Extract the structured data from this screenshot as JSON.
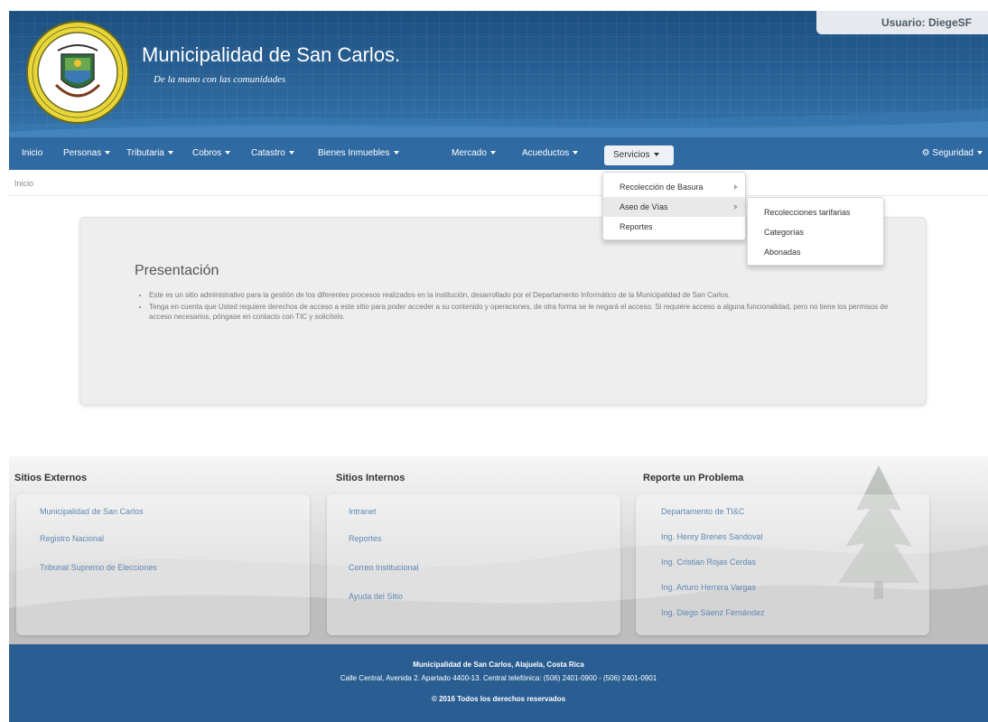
{
  "header": {
    "user_label": "Usuario: DiegeSF",
    "title": "Municipalidad de San Carlos.",
    "subtitle": "De la mano con las comunidades",
    "logo_text": "MUNICIPALIDAD DE SAN CARLOS",
    "colors": {
      "brand": "#2f6aa2",
      "header_dark": "#1d4f80",
      "logo_yellow": "#e7d53a"
    }
  },
  "nav": {
    "items": [
      {
        "label": "Inicio",
        "dropdown": false
      },
      {
        "label": "Personas",
        "dropdown": true
      },
      {
        "label": "Tributaria",
        "dropdown": true
      },
      {
        "label": "Cobros",
        "dropdown": true
      },
      {
        "label": "Catastro",
        "dropdown": true
      },
      {
        "label": "Bienes Inmuebles",
        "dropdown": true
      },
      {
        "label": "Mercado",
        "dropdown": true
      },
      {
        "label": "Acueductos",
        "dropdown": true
      }
    ],
    "active": "Servicios",
    "security": "Seguridad"
  },
  "breadcrumb": "Inicio",
  "dropdown": {
    "items": [
      "Recolección de Basura",
      "Aseo de Vías",
      "Reportes"
    ],
    "submenu": [
      "Recolecciones tarifarias",
      "Categorías",
      "Abonadas"
    ]
  },
  "presentation": {
    "title": "Presentación",
    "bullets": [
      "Este es un sitio administrativo para la gestión de los diferentes procesos realizados en la institución, desarrollado por el Departamento Informático de la Municipalidad de San Carlos.",
      "Tenga en cuenta que Usted requiere derechos de acceso a este sitio para poder acceder a su contenido y operaciones, de otra forma se le negará el acceso. Si requiere acceso a alguna funcionalidad, pero no tiene los permisos de acceso necesarios, póngase en contacto con TIC y solicítelo."
    ]
  },
  "footer": {
    "externos": {
      "title": "Sitios Externos",
      "links": [
        "Municipalidad de San Carlos",
        "Registro Nacional",
        "Tribunal Supremo de Elecciones"
      ]
    },
    "internos": {
      "title": "Sitios Internos",
      "links": [
        "Intranet",
        "Reportes",
        "Correo Institucional",
        "Ayuda del Sitio"
      ]
    },
    "reporte": {
      "title": "Reporte un Problema",
      "links": [
        "Departamento de TI&C",
        "Ing. Henry Brenes Sandoval",
        "Ing. Cristian Rojas Cerdas",
        "Ing. Arturo Herrera Vargas",
        "Ing. Diego Sáenz Fernández"
      ]
    },
    "line1": "Municipalidad de San Carlos, Alajuela, Costa Rica",
    "line2": "Calle Central, Avenida 2. Apartado 4400-13. Central telefónica: (506) 2401-0900 - (506) 2401-0901",
    "line3": "© 2016 Todos los derechos reservados"
  }
}
